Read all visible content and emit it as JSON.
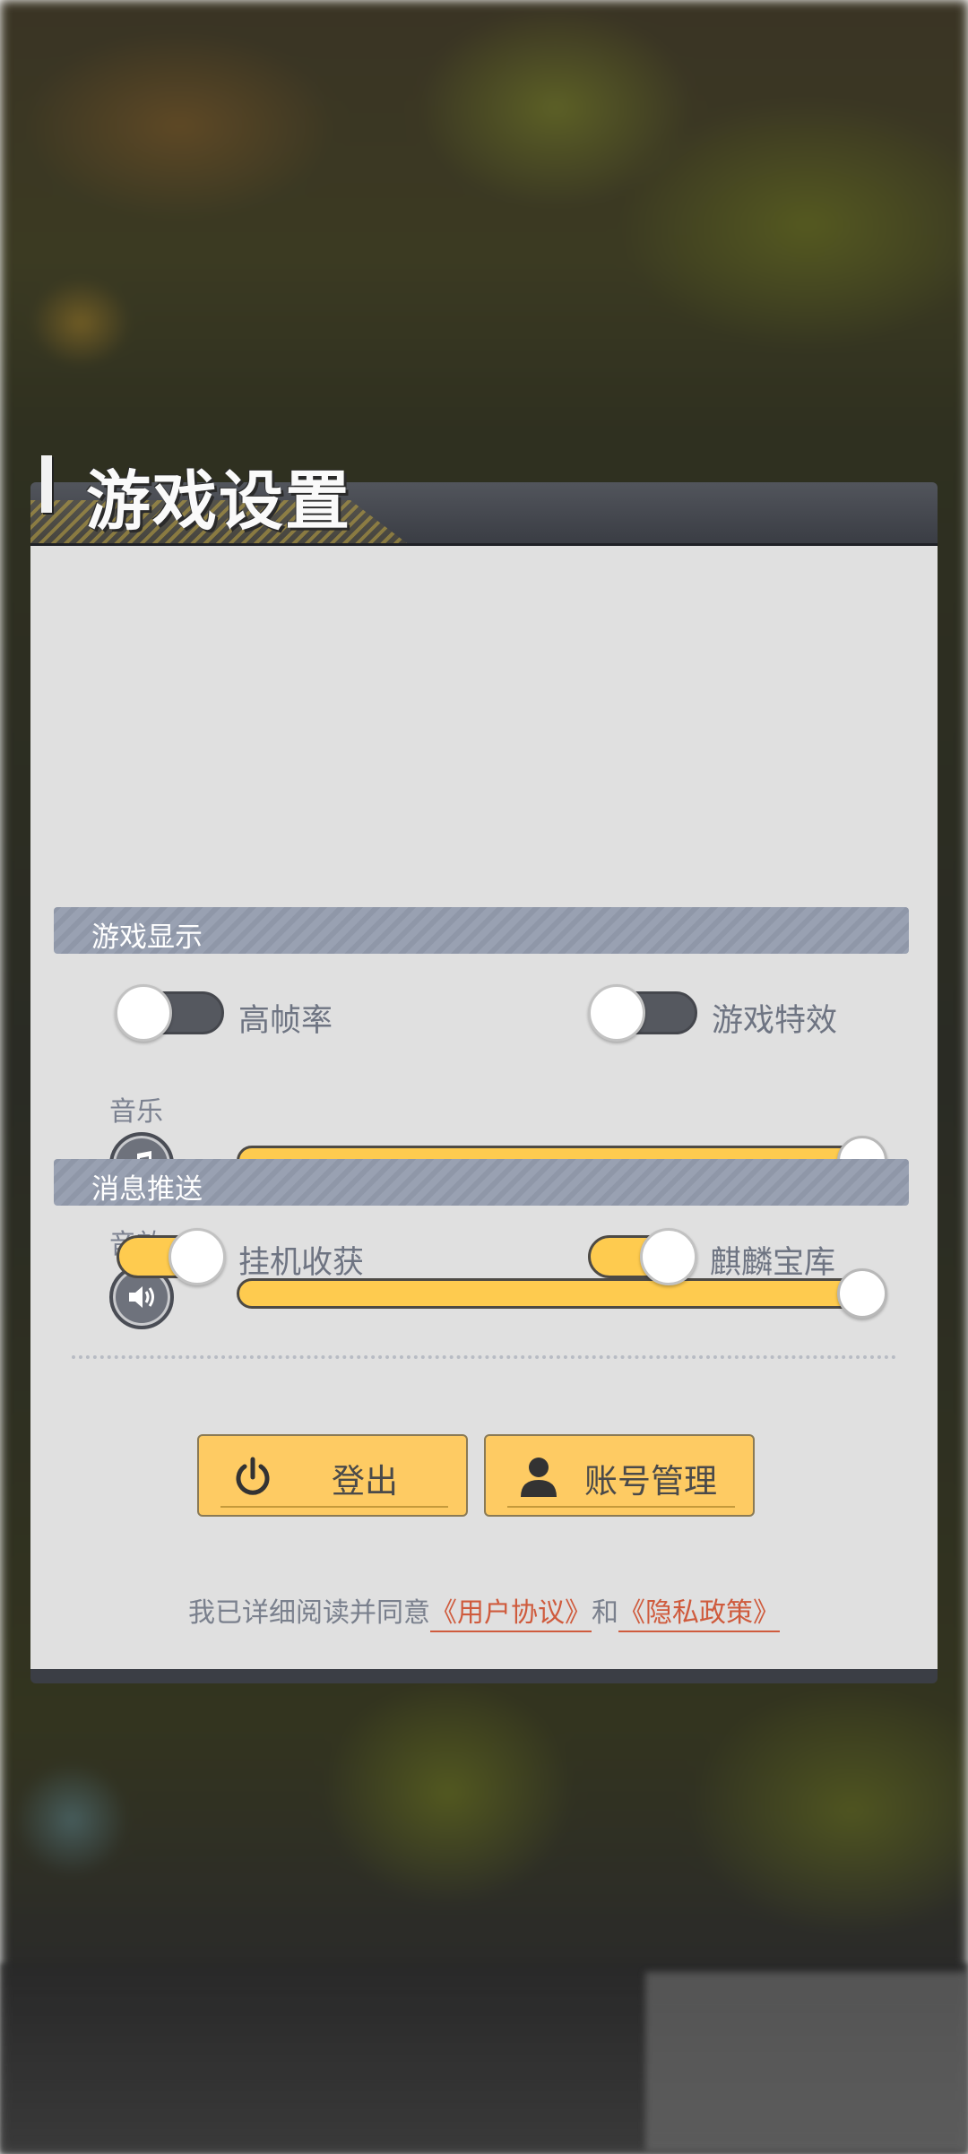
{
  "panel": {
    "title": "游戏设置"
  },
  "audio": {
    "music_label": "音乐",
    "music_level": 1.0,
    "sfx_label": "音效",
    "sfx_level": 1.0
  },
  "display": {
    "section_title": "游戏显示",
    "high_fps_label": "高帧率",
    "high_fps_on": false,
    "effects_label": "游戏特效",
    "effects_on": false
  },
  "push": {
    "section_title": "消息推送",
    "idle_harvest_label": "挂机收获",
    "idle_harvest_on": true,
    "treasury_label": "麒麟宝库",
    "treasury_on": true
  },
  "buttons": {
    "logout_label": "登出",
    "account_label": "账号管理"
  },
  "agreement": {
    "prefix": "我已详细阅读并同意",
    "user_agreement": "《用户协议》",
    "and": "和",
    "privacy_policy": "《隐私政策》"
  },
  "colors": {
    "accent_yellow": "#fecb4f",
    "link_red": "#cf5b3d",
    "section_bar": "#959daf"
  },
  "icons": [
    "music-icon",
    "speaker-icon",
    "power-icon",
    "user-icon"
  ]
}
